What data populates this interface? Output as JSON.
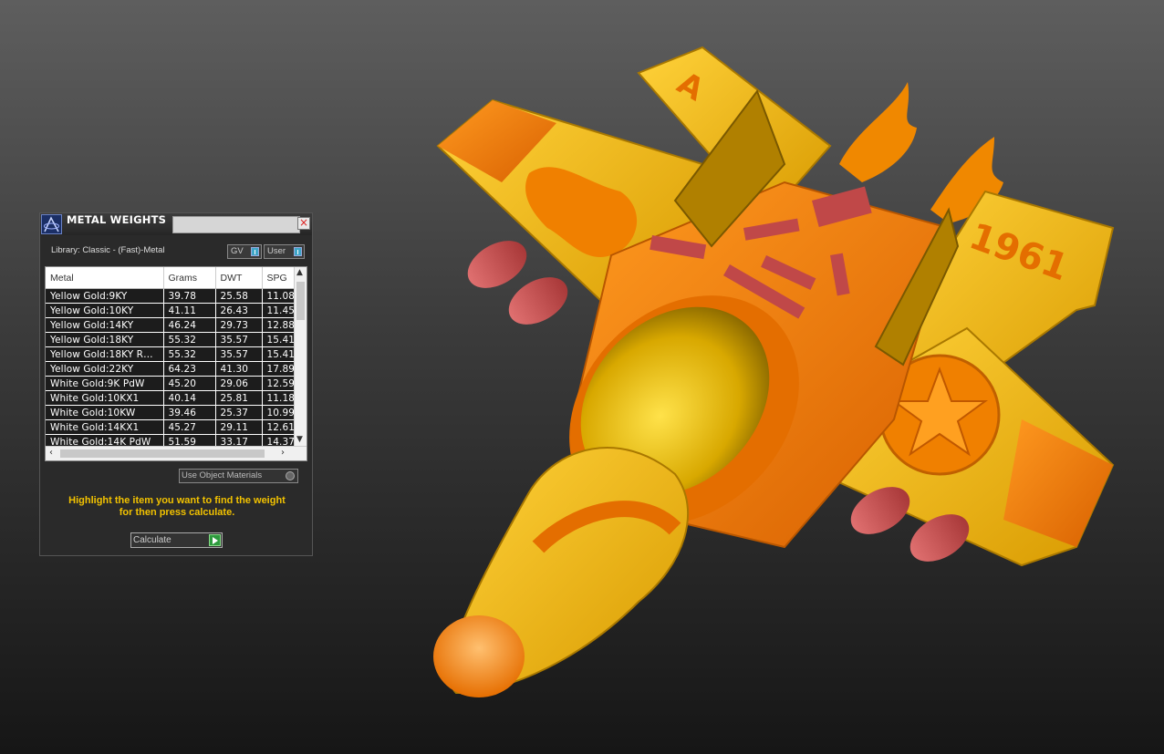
{
  "panel": {
    "title": "METAL WEIGHTS",
    "library_label": "Library: Classic - (Fast)-Metal",
    "toggle_gv": "GV",
    "toggle_user": "User",
    "close": "×",
    "columns": [
      "Metal",
      "Grams",
      "DWT",
      "SPG"
    ],
    "rows": [
      [
        "Yellow Gold:9KY",
        "39.78",
        "25.58",
        "11.08"
      ],
      [
        "Yellow Gold:10KY",
        "41.11",
        "26.43",
        "11.45"
      ],
      [
        "Yellow Gold:14KY",
        "46.24",
        "29.73",
        "12.88"
      ],
      [
        "Yellow Gold:18KY",
        "55.32",
        "35.57",
        "15.41"
      ],
      [
        "Yellow Gold:18KY R…",
        "55.32",
        "35.57",
        "15.41"
      ],
      [
        "Yellow Gold:22KY",
        "64.23",
        "41.30",
        "17.89"
      ],
      [
        "White Gold:9K PdW",
        "45.20",
        "29.06",
        "12.59"
      ],
      [
        "White Gold:10KX1",
        "40.14",
        "25.81",
        "11.18"
      ],
      [
        "White Gold:10KW",
        "39.46",
        "25.37",
        "10.99"
      ],
      [
        "White Gold:14KX1",
        "45.27",
        "29.11",
        "12.61"
      ],
      [
        "White Gold:14K PdW",
        "51.59",
        "33.17",
        "14.37"
      ]
    ],
    "use_object_materials": "Use Object Materials",
    "instruction_line1": "Highlight the item you want to find the weight",
    "instruction_line2": "for then press calculate.",
    "calculate_label": "Calculate"
  },
  "model": {
    "text_year": "1961",
    "text_letter": "A"
  },
  "colors": {
    "gold": "#f5b800",
    "orange": "#f07800",
    "red": "#c04848"
  }
}
